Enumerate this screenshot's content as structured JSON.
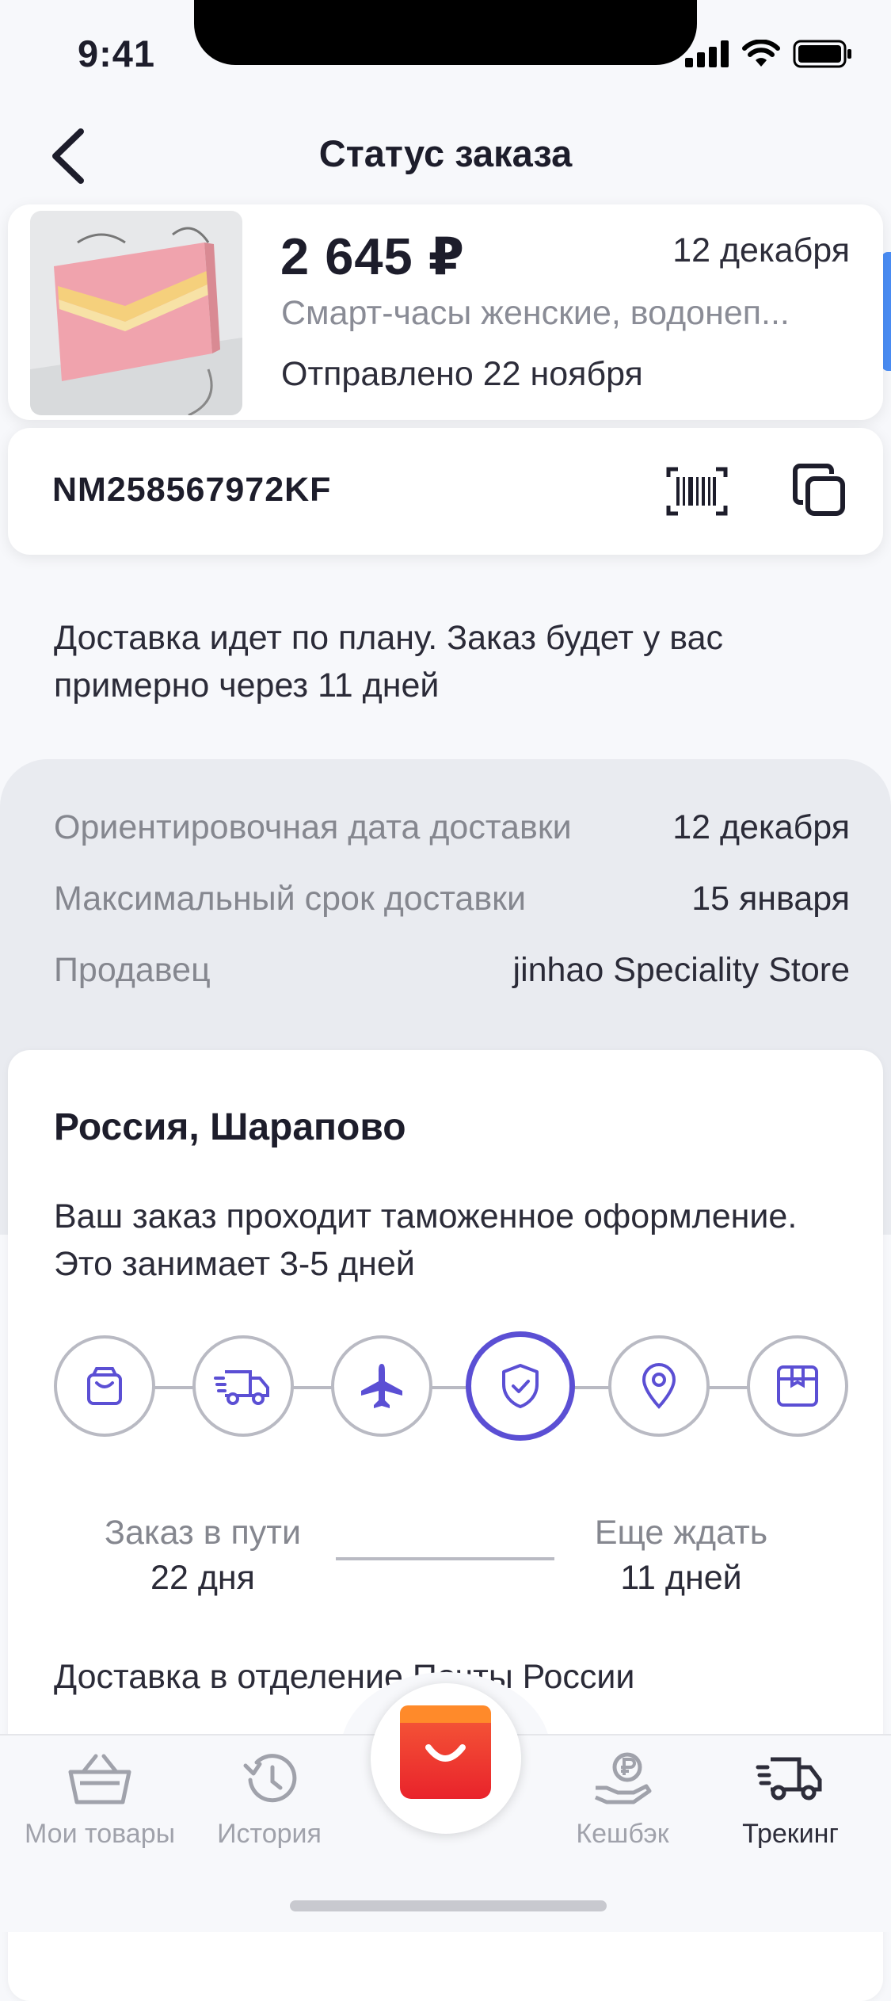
{
  "status_bar": {
    "time": "9:41"
  },
  "header": {
    "title": "Статус заказа"
  },
  "product": {
    "price": "2 645 ₽",
    "date": "12 декабря",
    "name": "Смарт-часы женские, водонеп...",
    "shipped": "Отправлено 22 ноября"
  },
  "tracking": {
    "number": "NM258567972KF"
  },
  "delivery_message": "Доставка идет по плану. Заказ будет у вас примерно через 11 дней",
  "details": [
    {
      "key": "Ориентировочная дата доставки",
      "value": "12 декабря"
    },
    {
      "key": "Максимальный срок доставки",
      "value": "15 января"
    },
    {
      "key": "Продавец",
      "value": "jinhao Speciality Store"
    }
  ],
  "location": {
    "city": "Россия, Шарапово",
    "description": "Ваш заказ проходит таможенное оформление. Это занимает 3-5 дней",
    "steps": [
      "bag-icon",
      "truck-icon",
      "plane-icon",
      "shield-check-icon",
      "location-pin-icon",
      "box-icon"
    ],
    "active_step_index": 3,
    "in_transit_label": "Заказ в пути",
    "in_transit_value": "22 дня",
    "wait_label": "Еще ждать",
    "wait_value": "11 дней",
    "delivery_point": "Доставка в отделение Почты России"
  },
  "bottom_nav": {
    "items": [
      {
        "label": "Мои товары",
        "icon": "basket-icon"
      },
      {
        "label": "История",
        "icon": "history-icon"
      },
      {
        "label": "Кешбэк",
        "icon": "cashback-icon"
      },
      {
        "label": "Трекинг",
        "icon": "truck-icon"
      }
    ],
    "active": "Трекинг"
  },
  "colors": {
    "accent": "#5b4fd4",
    "brand": "#e9232b",
    "text": "#1d1d2b",
    "muted": "#85878f"
  }
}
